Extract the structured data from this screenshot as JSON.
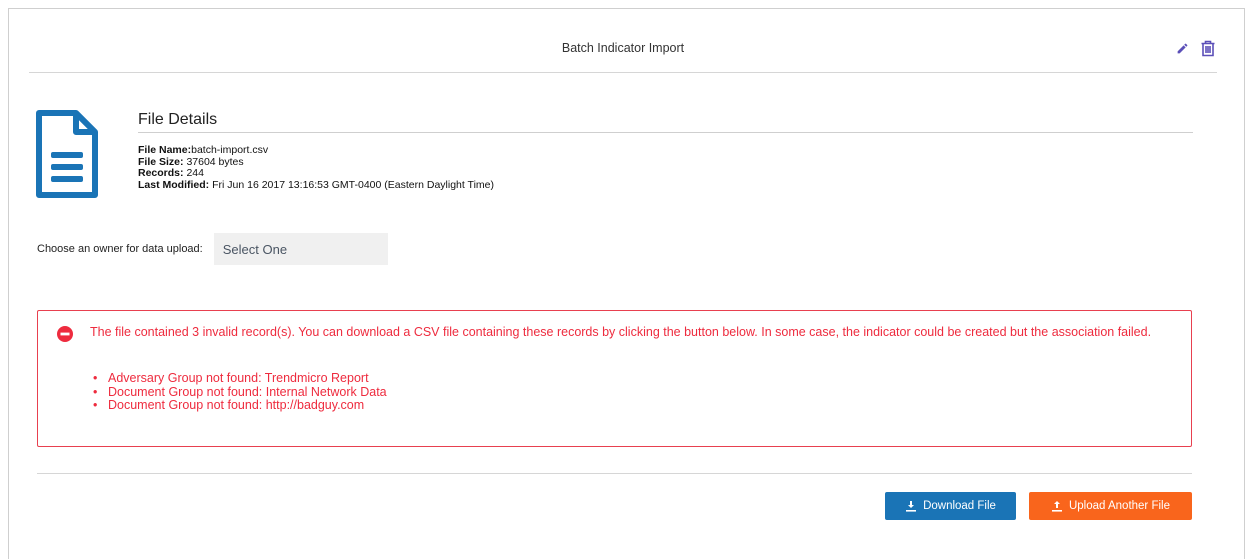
{
  "header": {
    "title": "Batch Indicator Import",
    "edit_icon": "pencil-icon",
    "delete_icon": "trash-icon"
  },
  "file_details": {
    "title": "File Details",
    "icon": "document-icon",
    "name_label": "File Name:",
    "name_value": "batch-import.csv",
    "size_label": "File Size:",
    "size_value": "37604 bytes",
    "records_label": "Records:",
    "records_value": "244",
    "modified_label": "Last Modified:",
    "modified_value": "Fri Jun 16 2017 13:16:53 GMT-0400 (Eastern Daylight Time)"
  },
  "owner": {
    "label": "Choose an owner for data upload:",
    "selected": "Select One"
  },
  "alert": {
    "icon": "minus-circle-icon",
    "message": "The file contained 3 invalid record(s). You can download a CSV file containing these records by clicking the button below. In some case, the indicator could be created but the association failed.",
    "errors": [
      "Adversary Group not found: Trendmicro Report",
      "Document Group not found: Internal Network Data",
      "Document Group not found: http://badguy.com"
    ]
  },
  "buttons": {
    "download_label": "Download File",
    "upload_label": "Upload Another File"
  },
  "colors": {
    "accent_purple": "#5b4fb8",
    "file_icon_blue": "#1a74b6",
    "error_red": "#ee2b3e",
    "download_blue": "#1a74b6",
    "upload_orange": "#f9651c"
  }
}
